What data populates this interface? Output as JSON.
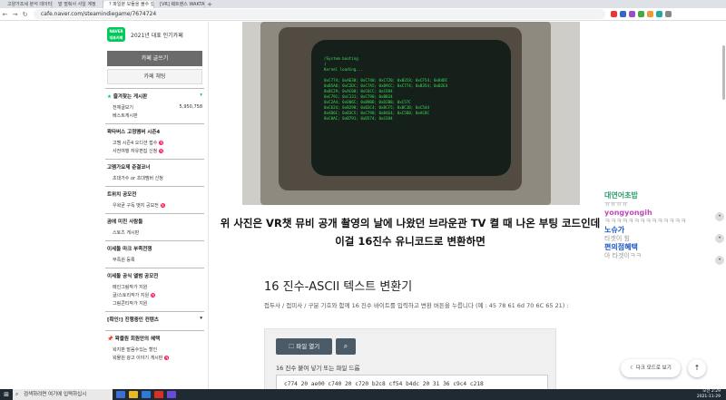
{
  "browser": {
    "tabs": [
      {
        "label": "고양가조세 분석 데이터"
      },
      {
        "label": "말 벌줘서 사일 계정"
      },
      {
        "label": "? 파일분 모듈을 불수 있어"
      },
      {
        "label": "[VR] 웨트랜스 WAKTAVERSE"
      },
      {
        "label": "+"
      }
    ],
    "url": "cafe.naver.com/steamindiegame/7674724"
  },
  "sidebar": {
    "badge": "NAVER 대표카페",
    "cafe_title": "2021년 대표 인기카페",
    "write_btn": "카페 글쓰기",
    "chat_btn": "카페 채팅",
    "favorites_head": "즐겨찾는 게시판",
    "all_posts": "전체글보기",
    "all_posts_count": "5,950,758",
    "best_posts": "베스트게시판",
    "sections": [
      {
        "title": "왁타버스 고정멤버 시즌4",
        "items": [
          "고멤 시즌4 오디션 접수",
          "사전여행 자유편집 신청"
        ]
      },
      {
        "title": "고멤가요제 준결코너",
        "items": [
          "초대가수 or 초대멤버 신청"
        ]
      },
      {
        "title": "트위치 공모전",
        "items": [
          "우왁굳 구독 뱃지 공모전"
        ]
      },
      {
        "title": "곰에 미친 사람들",
        "items": [
          "스토츠 게시판"
        ]
      },
      {
        "title": "이세돌 마크 부족전쟁",
        "items": [
          "부족원 등록"
        ]
      },
      {
        "title": "이세돌 공식 앨범 공모전",
        "items": [
          "메인그림작가 지원",
          "글/스토리작가 지원",
          "그림콘티작가 지원"
        ]
      },
      {
        "title": "[확인!] 진행중인 컨텐츠",
        "items": []
      },
      {
        "title": "왁물원 회원만의 혜택",
        "items": [
          "왁지판 발음수있는 할인",
          "왁물원 광고 이야기 게시판"
        ]
      }
    ]
  },
  "article": {
    "screen_lines": [
      "/System booting",
      "(",
      "Kernel loading...",
      "",
      "0xC774; 0xAE30; 0xC740; 0xC720; 0xB2C8; 0xCF54; 0xB4DC",
      "0xB5A8; 0xC2DC; 0xC7A5; 0xB9CC; 0xC774; 0xB354; 0xB2E4",
      "0xBC29; 0xAC00; 0xC6CC; 0xC694",
      "0xC791; 0xC131; 0xC790; 0xBB34",
      "0xC2A4; 0xD06C; 0xB9BD; 0xD2B8; 0xC57C",
      "0xC624; 0xB298; 0xB3C4; 0xBCF5; 0xBC1B; 0xC544",
      "0xAD6C; 0xB3C5; 0xC790; 0xB4E4; 0xC5D0; 0xAC8C",
      "0xC0AC; 0xB791; 0xD574; 0xC694"
    ],
    "caption": "위 사진은 VR챗 뮤비 공개 촬영의 날에 나왔던 브라운관 TV 켤 때 나온 부팅 코드인데 이걸 16진수 유니코드로 변환하면",
    "tool_title": "16 진수-ASCII 텍스트 변환기",
    "tool_desc": "접두사 / 접미사 / 구분 기호와 함께 16 진수 바이트를 입력하고 변환 버튼을 누릅니다 (예 : 45 78 61 6d 70 6C 65 21) :",
    "open_btn": "파일 열기",
    "input_label": "16 진수 붙여 넣기 또는 파일 드롭",
    "hex_value": "c774 20 ae00 c740 20 c720 b2c8 cf54 b4dc 20 31 36 c9c4 c218"
  },
  "chat": [
    {
      "name": "대연어초밥",
      "msg": "ㅠㅠㅠㅠ",
      "color": "#2a9d6a"
    },
    {
      "name": "yongyongih",
      "msg": "ㅋㅋㅋㅋㅋㅋㅋㅋㅋㅋㅋㅋㅋㅋ",
      "color": "#c04ab8"
    },
    {
      "name": "노슈가",
      "msg": "타겟이 힘",
      "color": "#1a56c8"
    },
    {
      "name": "편의점혜택",
      "msg": "아 타겟이ㅋㅋ",
      "color": "#1a56c8"
    }
  ],
  "floating": {
    "dark_mode": "다크 모드로 보기",
    "top": "↑"
  },
  "taskbar": {
    "search": "검색하려면 여기에 입력하십시",
    "clock_time": "오전 2:29",
    "clock_date": "2021-11-29"
  }
}
